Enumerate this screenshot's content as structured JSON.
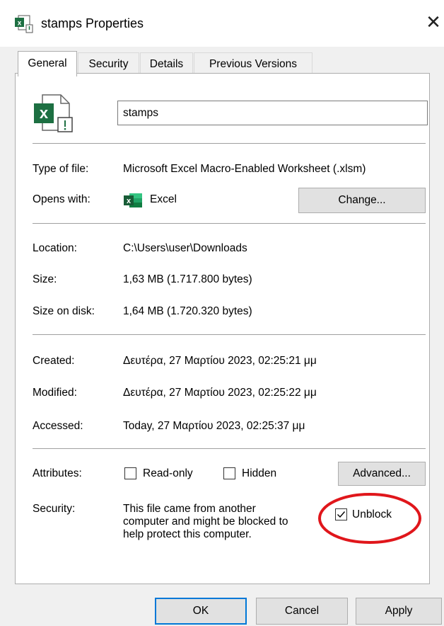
{
  "window": {
    "title": "stamps Properties",
    "icon": "excel-file-blocked-icon",
    "close_glyph": "✕"
  },
  "tabs": [
    {
      "label": "General",
      "active": true
    },
    {
      "label": "Security",
      "active": false
    },
    {
      "label": "Details",
      "active": false
    },
    {
      "label": "Previous Versions",
      "active": false
    }
  ],
  "general": {
    "file_name": "stamps",
    "type_of_file": {
      "label": "Type of file:",
      "value": "Microsoft Excel Macro-Enabled Worksheet (.xlsm)"
    },
    "opens_with": {
      "label": "Opens with:",
      "value": "Excel",
      "change_button": "Change..."
    },
    "location": {
      "label": "Location:",
      "value": "C:\\Users\\user\\Downloads"
    },
    "size": {
      "label": "Size:",
      "value": "1,63 MB (1.717.800 bytes)"
    },
    "size_on_disk": {
      "label": "Size on disk:",
      "value": "1,64 MB (1.720.320 bytes)"
    },
    "created": {
      "label": "Created:",
      "value": "Δευτέρα, 27 Μαρτίου 2023, 02:25:21 μμ"
    },
    "modified": {
      "label": "Modified:",
      "value": "Δευτέρα, 27 Μαρτίου 2023, 02:25:22 μμ"
    },
    "accessed": {
      "label": "Accessed:",
      "value": "Today, 27 Μαρτίου 2023, 02:25:37 μμ"
    },
    "attributes": {
      "label": "Attributes:",
      "read_only": {
        "label": "Read-only",
        "checked": false
      },
      "hidden": {
        "label": "Hidden",
        "checked": false
      },
      "advanced_button": "Advanced..."
    },
    "security": {
      "label": "Security:",
      "message_lines": [
        "This file came from another",
        "computer and might be blocked to",
        "help protect this computer."
      ],
      "unblock": {
        "label": "Unblock",
        "checked": true
      }
    }
  },
  "buttons": {
    "ok": "OK",
    "cancel": "Cancel",
    "apply": "Apply"
  },
  "colors": {
    "excel_green": "#1d6f42",
    "annotation_red": "#e0161b",
    "default_button_border": "#0078d7",
    "panel_bg": "#ffffff",
    "dialog_bg": "#f0f0f0"
  }
}
